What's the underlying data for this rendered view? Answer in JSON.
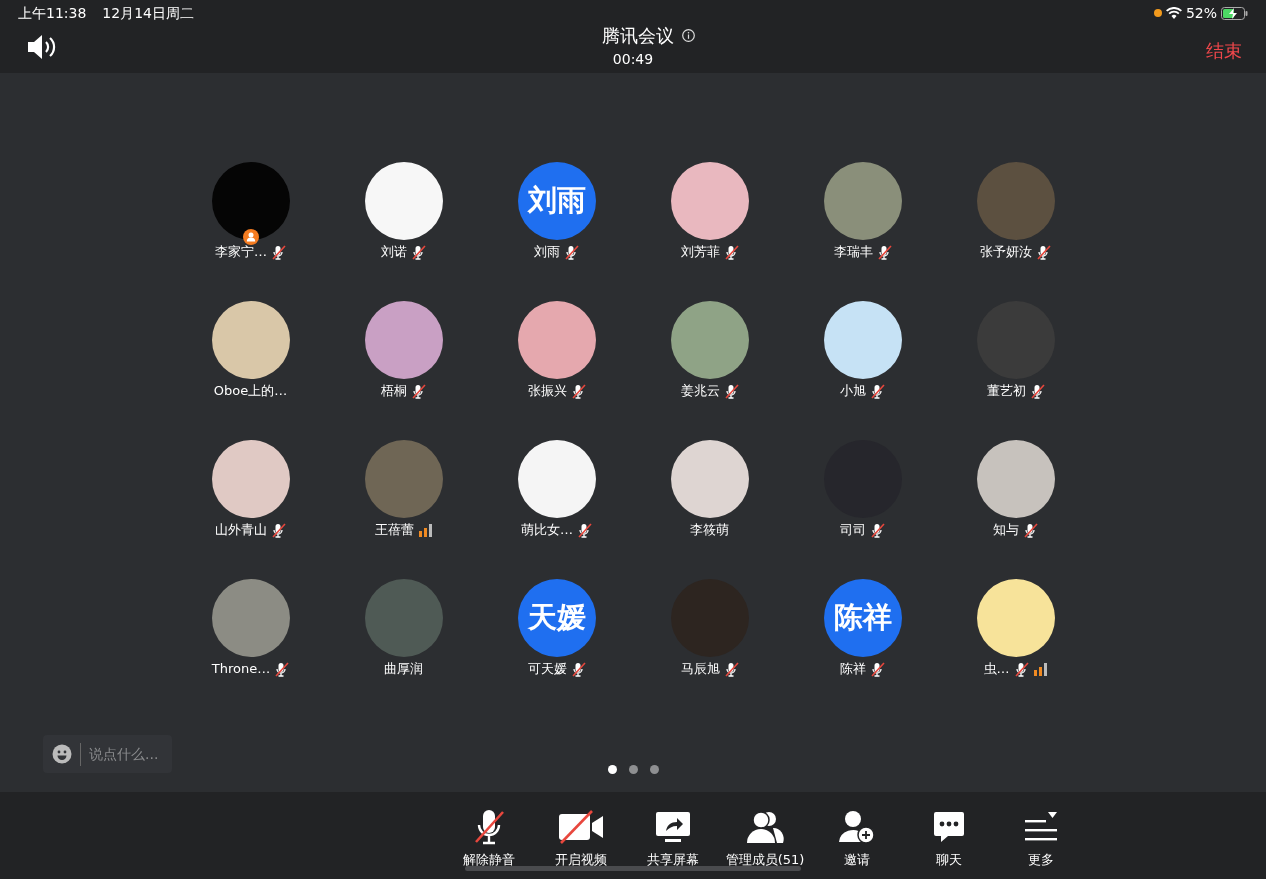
{
  "status_bar": {
    "time": "上午11:38",
    "date": "12月14日周二",
    "battery": "52%"
  },
  "header": {
    "title": "腾讯会议",
    "timer": "00:49",
    "end_button": "结束"
  },
  "participants": [
    {
      "name": "李家宁…",
      "avatar": {
        "kind": "photo"
      },
      "host": true,
      "muted": true,
      "signal": false
    },
    {
      "name": "刘诺",
      "avatar": {
        "kind": "photo"
      },
      "host": false,
      "muted": true,
      "signal": false
    },
    {
      "name": "刘雨",
      "avatar": {
        "kind": "text",
        "text": "刘雨"
      },
      "host": false,
      "muted": true,
      "signal": false
    },
    {
      "name": "刘芳菲",
      "avatar": {
        "kind": "photo"
      },
      "host": false,
      "muted": true,
      "signal": false
    },
    {
      "name": "李瑞丰",
      "avatar": {
        "kind": "photo"
      },
      "host": false,
      "muted": true,
      "signal": false
    },
    {
      "name": "张予妍汝",
      "avatar": {
        "kind": "photo"
      },
      "host": false,
      "muted": true,
      "signal": false
    },
    {
      "name": "Oboe上的…",
      "avatar": {
        "kind": "photo"
      },
      "host": false,
      "muted": false,
      "signal": false
    },
    {
      "name": "梧桐",
      "avatar": {
        "kind": "photo"
      },
      "host": false,
      "muted": true,
      "signal": false
    },
    {
      "name": "张振兴",
      "avatar": {
        "kind": "photo"
      },
      "host": false,
      "muted": true,
      "signal": false
    },
    {
      "name": "姜兆云",
      "avatar": {
        "kind": "photo"
      },
      "host": false,
      "muted": true,
      "signal": false
    },
    {
      "name": "小旭",
      "avatar": {
        "kind": "photo"
      },
      "host": false,
      "muted": true,
      "signal": false
    },
    {
      "name": "董艺初",
      "avatar": {
        "kind": "photo"
      },
      "host": false,
      "muted": true,
      "signal": false
    },
    {
      "name": "山外青山",
      "avatar": {
        "kind": "photo"
      },
      "host": false,
      "muted": true,
      "signal": false
    },
    {
      "name": "王蓓蕾",
      "avatar": {
        "kind": "photo"
      },
      "host": false,
      "muted": false,
      "signal": true
    },
    {
      "name": "萌比女…",
      "avatar": {
        "kind": "photo"
      },
      "host": false,
      "muted": true,
      "signal": false
    },
    {
      "name": "李筱萌",
      "avatar": {
        "kind": "photo"
      },
      "host": false,
      "muted": false,
      "signal": false
    },
    {
      "name": "司司",
      "avatar": {
        "kind": "photo"
      },
      "host": false,
      "muted": true,
      "signal": false
    },
    {
      "name": "知与",
      "avatar": {
        "kind": "photo"
      },
      "host": false,
      "muted": true,
      "signal": false
    },
    {
      "name": "Throne…",
      "avatar": {
        "kind": "photo"
      },
      "host": false,
      "muted": true,
      "signal": false
    },
    {
      "name": "曲厚润",
      "avatar": {
        "kind": "photo"
      },
      "host": false,
      "muted": false,
      "signal": false
    },
    {
      "name": "可天媛",
      "avatar": {
        "kind": "text",
        "text": "天媛"
      },
      "host": false,
      "muted": true,
      "signal": false
    },
    {
      "name": "马辰旭",
      "avatar": {
        "kind": "photo"
      },
      "host": false,
      "muted": true,
      "signal": false
    },
    {
      "name": "陈祥",
      "avatar": {
        "kind": "text",
        "text": "陈祥"
      },
      "host": false,
      "muted": true,
      "signal": false
    },
    {
      "name": "虫…",
      "avatar": {
        "kind": "photo"
      },
      "host": false,
      "muted": true,
      "signal": true
    }
  ],
  "chat_input": {
    "placeholder": "说点什么..."
  },
  "pages": [
    {
      "selected": true
    },
    {
      "selected": false
    },
    {
      "selected": false
    }
  ],
  "toolbar": [
    {
      "kind": "mic",
      "label": "解除静音"
    },
    {
      "kind": "video",
      "label": "开启视频"
    },
    {
      "kind": "share",
      "label": "共享屏幕"
    },
    {
      "kind": "members",
      "label": "管理成员(51)"
    },
    {
      "kind": "invite",
      "label": "邀请"
    },
    {
      "kind": "chat",
      "label": "聊天"
    },
    {
      "kind": "more",
      "label": "更多"
    }
  ]
}
